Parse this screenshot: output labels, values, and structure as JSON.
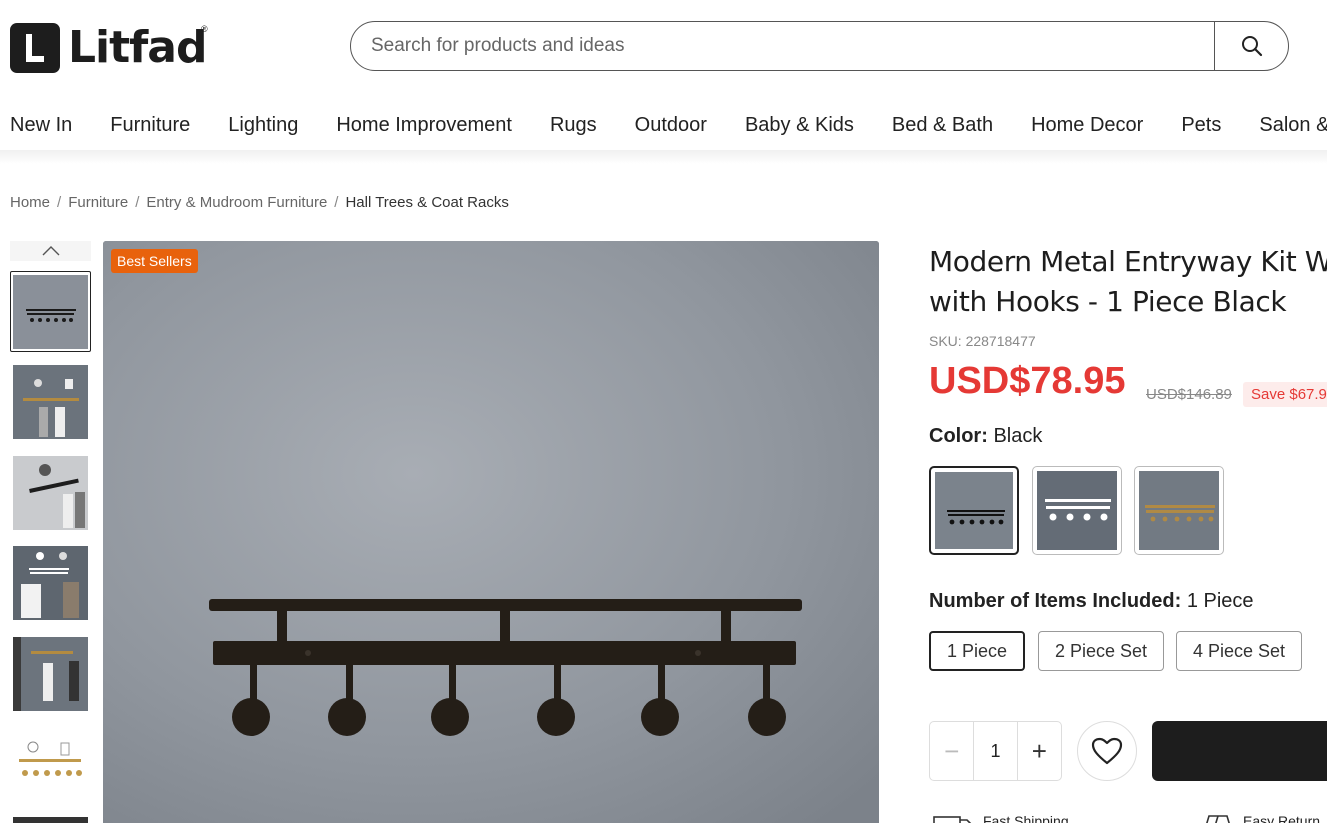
{
  "header": {
    "logo_text": "Litfad",
    "logo_reg": "®",
    "search_placeholder": "Search for products and ideas"
  },
  "nav": [
    "New In",
    "Furniture",
    "Lighting",
    "Home Improvement",
    "Rugs",
    "Outdoor",
    "Baby & Kids",
    "Bed & Bath",
    "Home Decor",
    "Pets",
    "Salon &"
  ],
  "breadcrumb": {
    "items": [
      "Home",
      "Furniture",
      "Entry & Mudroom Furniture"
    ],
    "current": "Hall Trees & Coat Racks",
    "separator": "/"
  },
  "gallery": {
    "badge": "Best Sellers"
  },
  "product": {
    "title_line1": "Modern Metal Entryway Kit W",
    "title_line2": "with Hooks - 1 Piece Black",
    "sku": "SKU: 228718477",
    "price": "USD$78.95",
    "old_price": "USD$146.89",
    "save": "Save $67.9",
    "color_label": "Color:",
    "color_value": "Black",
    "items_label": "Number of Items Included:",
    "items_value": "1 Piece",
    "options": [
      "1 Piece",
      "2 Piece Set",
      "4 Piece Set"
    ],
    "quantity": "1",
    "minus": "−",
    "plus": "+"
  },
  "features": [
    "Fast Shipping",
    "Easy Return"
  ],
  "colors": {
    "accent_red": "#e53935",
    "badge_orange": "#e8620c",
    "dark": "#1d1d1d"
  }
}
